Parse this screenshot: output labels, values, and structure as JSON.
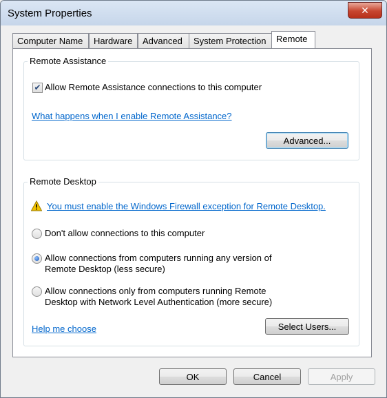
{
  "window": {
    "title": "System Properties",
    "close_label": "✕"
  },
  "tabs": [
    "Computer Name",
    "Hardware",
    "Advanced",
    "System Protection",
    "Remote"
  ],
  "remote_assistance": {
    "group_label": "Remote Assistance",
    "checkbox_checked": true,
    "checkbox_label": "Allow Remote Assistance connections to this computer",
    "help_link": "What happens when I enable Remote Assistance?",
    "advanced_button": "Advanced..."
  },
  "remote_desktop": {
    "group_label": "Remote Desktop",
    "warning_link": "You must enable the Windows Firewall exception for Remote Desktop.",
    "options": [
      {
        "line1": "Don't allow connections to this computer",
        "line2": "",
        "selected": false
      },
      {
        "line1": "Allow connections from computers running any version of",
        "line2": "Remote Desktop (less secure)",
        "selected": true
      },
      {
        "line1": "Allow connections only from computers running Remote",
        "line2": "Desktop with Network Level Authentication (more secure)",
        "selected": false
      }
    ],
    "help_link": "Help me choose",
    "select_users_button": "Select Users..."
  },
  "footer": {
    "ok": "OK",
    "cancel": "Cancel",
    "apply": "Apply"
  },
  "colors": {
    "link": "#0066cc",
    "warning": "#f2c200"
  }
}
